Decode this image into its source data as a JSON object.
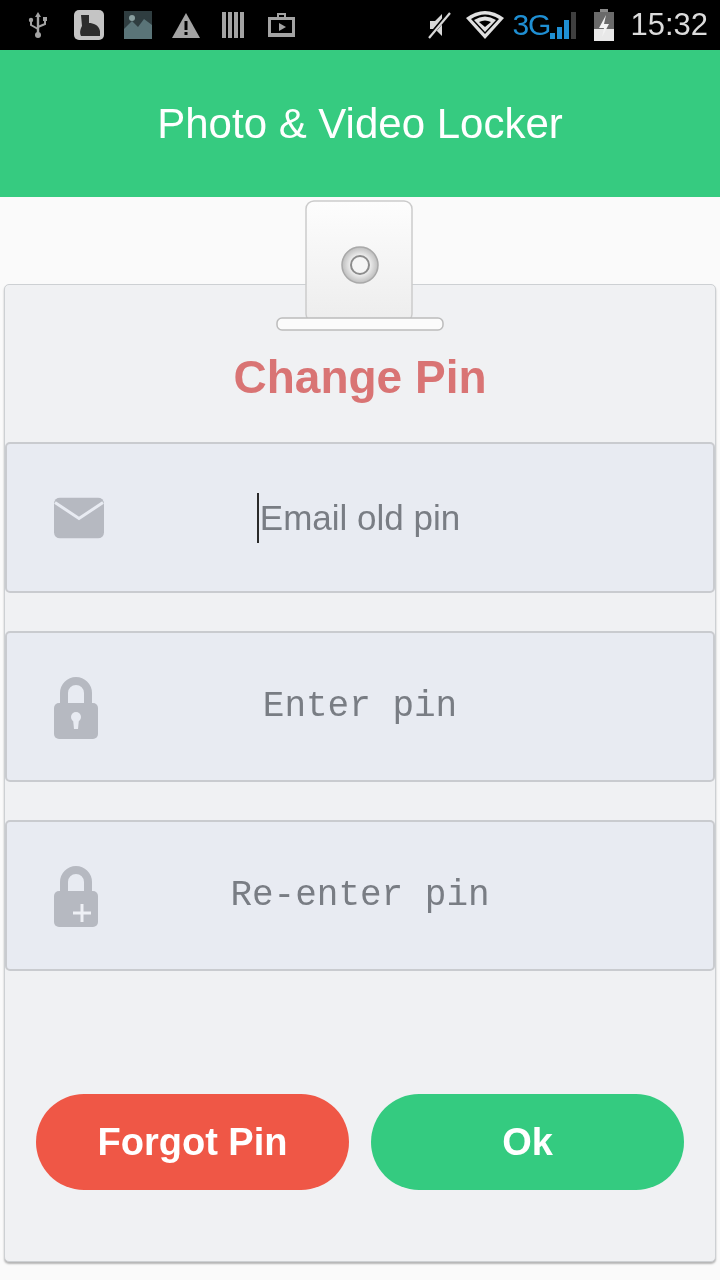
{
  "status_bar": {
    "network": "3G",
    "time": "15:32"
  },
  "app_bar": {
    "title": "Photo & Video Locker"
  },
  "dialog": {
    "title": "Change Pin",
    "fields": [
      {
        "kind": "email",
        "placeholder": "Email old pin",
        "focused": true
      },
      {
        "kind": "pin",
        "placeholder": "Enter pin",
        "focused": false
      },
      {
        "kind": "confirm_pin",
        "placeholder": "Re-enter pin",
        "focused": false
      }
    ],
    "buttons": [
      {
        "kind": "danger",
        "label": "Forgot Pin"
      },
      {
        "kind": "primary",
        "label": "Ok"
      }
    ]
  }
}
